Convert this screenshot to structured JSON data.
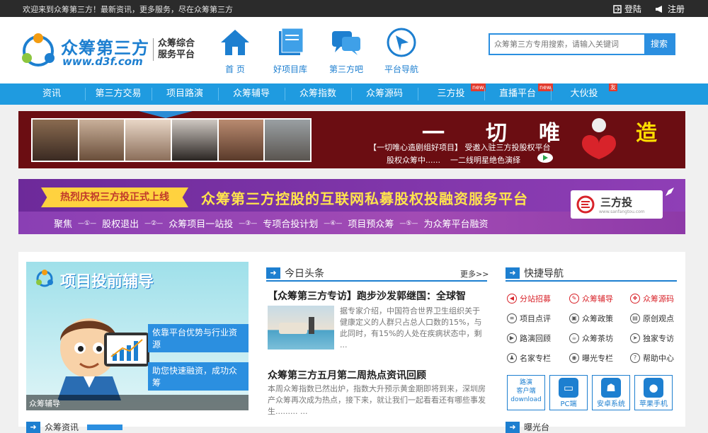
{
  "topbar": {
    "welcome": "欢迎来到众筹第三方！最新资讯，更多服务，尽在众筹第三方",
    "login": "登陆",
    "register": "注册"
  },
  "logo": {
    "brand": "众筹第三方",
    "url": "www.d3f.com",
    "slogan": "众筹综合服务平台"
  },
  "nav_icons": [
    {
      "label": "首 页",
      "icon": "home-icon"
    },
    {
      "label": "好项目库",
      "icon": "book-icon"
    },
    {
      "label": "第三方吧",
      "icon": "chat-icon"
    },
    {
      "label": "平台导航",
      "icon": "navigation-icon"
    }
  ],
  "search": {
    "placeholder": "众筹第三方专用搜索，请输入关键词",
    "button": "搜索"
  },
  "menu": [
    {
      "label": "资讯"
    },
    {
      "label": "第三方交易"
    },
    {
      "label": "项目路演"
    },
    {
      "label": "众筹辅导"
    },
    {
      "label": "众筹指数"
    },
    {
      "label": "众筹源码"
    },
    {
      "label": "三方投",
      "badge": "new"
    },
    {
      "label": "直播平台",
      "badge": "new"
    },
    {
      "label": "大伙投",
      "badge": "友"
    }
  ],
  "banner1": {
    "big_chars": [
      "一",
      "切",
      "唯",
      "造"
    ],
    "line1": "【一切唯心造剧组好项目】 受邀入驻三方投股权平台",
    "line2": "股权众筹中......    一二线明星绝色演绎"
  },
  "banner2": {
    "ribbon": "热烈庆祝三方投正式上线",
    "headline": "众筹第三方控股的互联网私募股权投融资服务平台",
    "logo_text": "三方投",
    "logo_url": "www.sanfangtou.com",
    "steps": [
      "聚焦",
      "股权退出",
      "众筹项目一站投",
      "专项合投计划",
      "项目预众筹",
      "为众筹平台融资"
    ]
  },
  "promo": {
    "title": "项目投前辅导",
    "bubble1": "依靠平台优势与行业资源",
    "bubble2": "助您快速融资，成功众筹",
    "caption": "众筹辅导"
  },
  "headlines": {
    "title": "今日头条",
    "more": "更多>>",
    "item1_title": "【众筹第三方专访】跑步沙发郭继国：全球智",
    "item1_body": "据专家介绍，中国符合世界卫生组织关于健康定义的人群只占总人口数的15%，与此同时，有15%的人处在疾病状态中，剩下70%...",
    "item1_ellipsis": "...",
    "item2_title": "众筹第三方五月第二周热点资讯回顾",
    "item2_body": "本周众筹指数已然出炉，指数大升预示黄金期即将到来，深圳房产众筹再次成为热点，接下来，就让我们一起看看还有哪些事发生......... ..."
  },
  "quicknav": {
    "title": "快捷导航",
    "items": [
      {
        "label": "分站招募",
        "color": "#d8232a",
        "icon": "megaphone-icon"
      },
      {
        "label": "众筹辅导",
        "color": "#d8232a",
        "icon": "guide-icon"
      },
      {
        "label": "众筹源码",
        "color": "#d8232a",
        "icon": "code-icon"
      },
      {
        "label": "项目点评",
        "color": "#333333",
        "icon": "list-icon"
      },
      {
        "label": "众筹政策",
        "color": "#333333",
        "icon": "policy-icon"
      },
      {
        "label": "原创观点",
        "color": "#333333",
        "icon": "document-icon"
      },
      {
        "label": "路演回顾",
        "color": "#333333",
        "icon": "play-icon"
      },
      {
        "label": "众筹茶坊",
        "color": "#333333",
        "icon": "tea-icon"
      },
      {
        "label": "独家专访",
        "color": "#333333",
        "icon": "interview-icon"
      },
      {
        "label": "名家专栏",
        "color": "#333333",
        "icon": "user-icon"
      },
      {
        "label": "曝光专栏",
        "color": "#333333",
        "icon": "eye-icon"
      },
      {
        "label": "帮助中心",
        "color": "#333333",
        "icon": "help-icon"
      }
    ],
    "apps": [
      {
        "label": "路演\n客户端\ndownload"
      },
      {
        "label": "PC端"
      },
      {
        "label": "安卓系统"
      },
      {
        "label": "苹果手机"
      }
    ]
  },
  "bottom": {
    "left_label": "众筹资讯",
    "right_label": "曝光台"
  },
  "colors": {
    "brand_blue": "#1d7fd0",
    "nav_blue": "#1f9be0",
    "topbar": "#2b2b2b",
    "accent_red": "#d8232a"
  }
}
